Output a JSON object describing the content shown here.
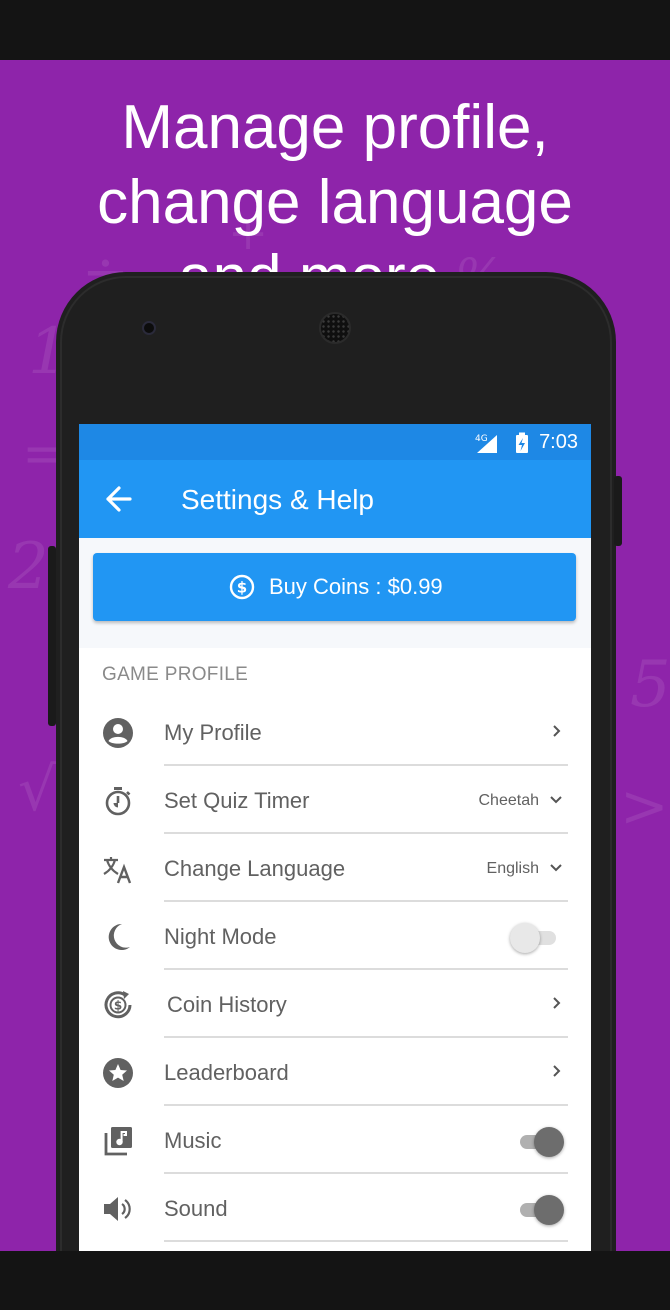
{
  "promo": {
    "headline": [
      "Manage profile,",
      "change language",
      "and more..."
    ],
    "background_color": "#8e24aa"
  },
  "status_bar": {
    "network": "4G",
    "time": "7:03"
  },
  "app_bar": {
    "title": "Settings & Help",
    "back_icon": "arrow-back-icon"
  },
  "buy_coins": {
    "label": "Buy Coins : $0.99",
    "icon": "dollar-circle-icon"
  },
  "settings": {
    "section_title": "GAME PROFILE",
    "items": [
      {
        "label": "My Profile",
        "icon": "account-circle-icon",
        "control": "chevron"
      },
      {
        "label": "Set Quiz Timer",
        "icon": "stopwatch-icon",
        "control": "dropdown",
        "value": "Cheetah"
      },
      {
        "label": "Change Language",
        "icon": "translate-icon",
        "control": "dropdown",
        "value": "English"
      },
      {
        "label": "Night Mode",
        "icon": "moon-icon",
        "control": "toggle",
        "enabled": false
      },
      {
        "label": "Coin History",
        "icon": "coin-history-icon",
        "control": "chevron"
      },
      {
        "label": "Leaderboard",
        "icon": "star-circle-icon",
        "control": "chevron"
      },
      {
        "label": "Music",
        "icon": "music-library-icon",
        "control": "toggle",
        "enabled": true
      },
      {
        "label": "Sound",
        "icon": "speaker-icon",
        "control": "toggle",
        "enabled": true
      }
    ]
  },
  "colors": {
    "primary": "#2196f3",
    "status_bar": "#1e88e5",
    "icon_grey": "#616161"
  }
}
